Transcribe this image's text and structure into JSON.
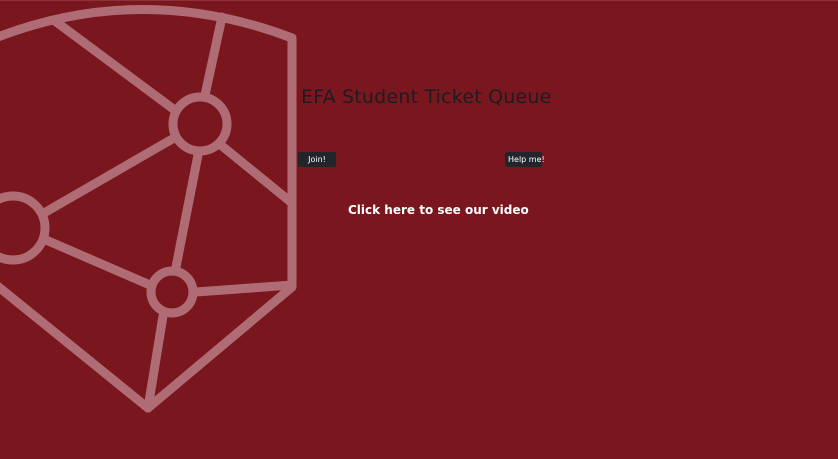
{
  "page": {
    "title": "EFA Student Ticket Queue",
    "background_color": "#7a171e",
    "title_color": "#1c1c22"
  },
  "logo": {
    "icon": "shield-network-icon",
    "color": "#b06c74"
  },
  "actions": {
    "join_label": "Join!",
    "help_label": "Help me!",
    "button_color": "#22262c"
  },
  "video": {
    "link_text": "Click here to see our video"
  }
}
